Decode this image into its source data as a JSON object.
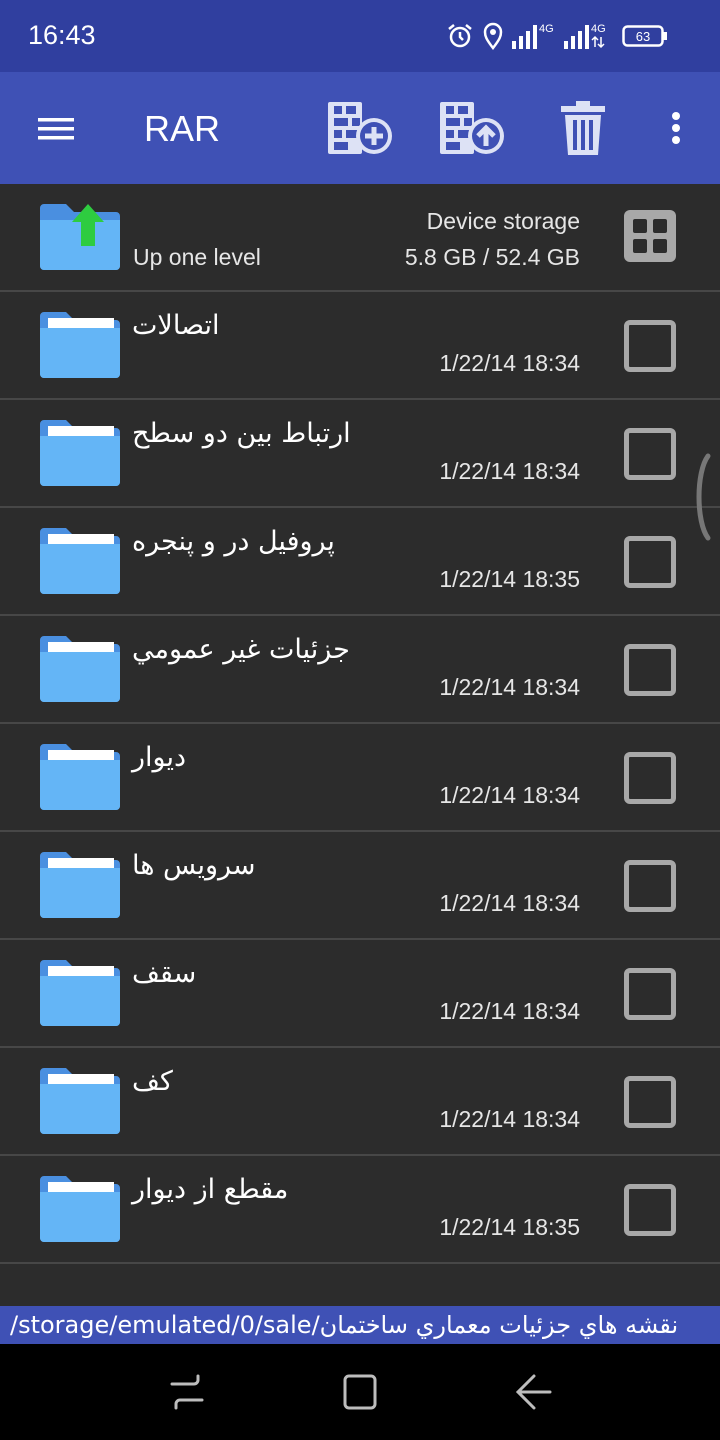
{
  "status_bar": {
    "time": "16:43",
    "icons": [
      "alarm-icon",
      "location-icon",
      "signal-icon",
      "signal-icon"
    ],
    "network_1": "4G",
    "network_2": "4G",
    "battery": "63"
  },
  "toolbar": {
    "title": "RAR",
    "icons": [
      "menu-icon",
      "archive-add-icon",
      "archive-extract-icon",
      "trash-icon",
      "more-vert-icon"
    ]
  },
  "up_row": {
    "label": "Up one level",
    "storage_label": "Device storage",
    "storage_value": "5.8 GB / 52.4 GB"
  },
  "folders": [
    {
      "name": "اتصالات",
      "date": "1/22/14 18:34"
    },
    {
      "name": "ارتباط بین دو سطح",
      "date": "1/22/14 18:34"
    },
    {
      "name": "پروفیل در و پنجره",
      "date": "1/22/14 18:35"
    },
    {
      "name": "جزئیات غیر عمومي",
      "date": "1/22/14 18:34"
    },
    {
      "name": "دیوار",
      "date": "1/22/14 18:34"
    },
    {
      "name": "سرویس ها",
      "date": "1/22/14 18:34"
    },
    {
      "name": "سقف",
      "date": "1/22/14 18:34"
    },
    {
      "name": "کف",
      "date": "1/22/14 18:34"
    },
    {
      "name": "مقطع از دیوار",
      "date": "1/22/14 18:35"
    }
  ],
  "path": "/storage/emulated/0/sale/نقشه هاي جزئیات معماري ساختمان",
  "colors": {
    "status_bar": "#303f9f",
    "app_bar": "#3f51b5",
    "background": "#2c2c2c",
    "folder": "#64b5f6",
    "up_arrow": "#2ecc40"
  }
}
